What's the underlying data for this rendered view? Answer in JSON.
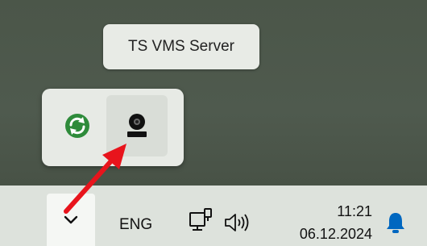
{
  "tooltip": {
    "text": "TS VMS Server"
  },
  "tray_popup": {
    "icons": [
      {
        "icon": "sync-icon",
        "color": "#2e8b3a"
      },
      {
        "icon": "webcam-icon",
        "color": "#111111"
      }
    ]
  },
  "taskbar": {
    "overflow_chevron": "chevron-down-icon",
    "language": "ENG",
    "network_icon": "network-icon",
    "volume_icon": "volume-icon",
    "time": "11:21",
    "date": "06.12.2024",
    "notification_icon": "bell-icon",
    "accent": "#0067c0"
  },
  "annotation": {
    "arrow_color": "#e8141c"
  }
}
